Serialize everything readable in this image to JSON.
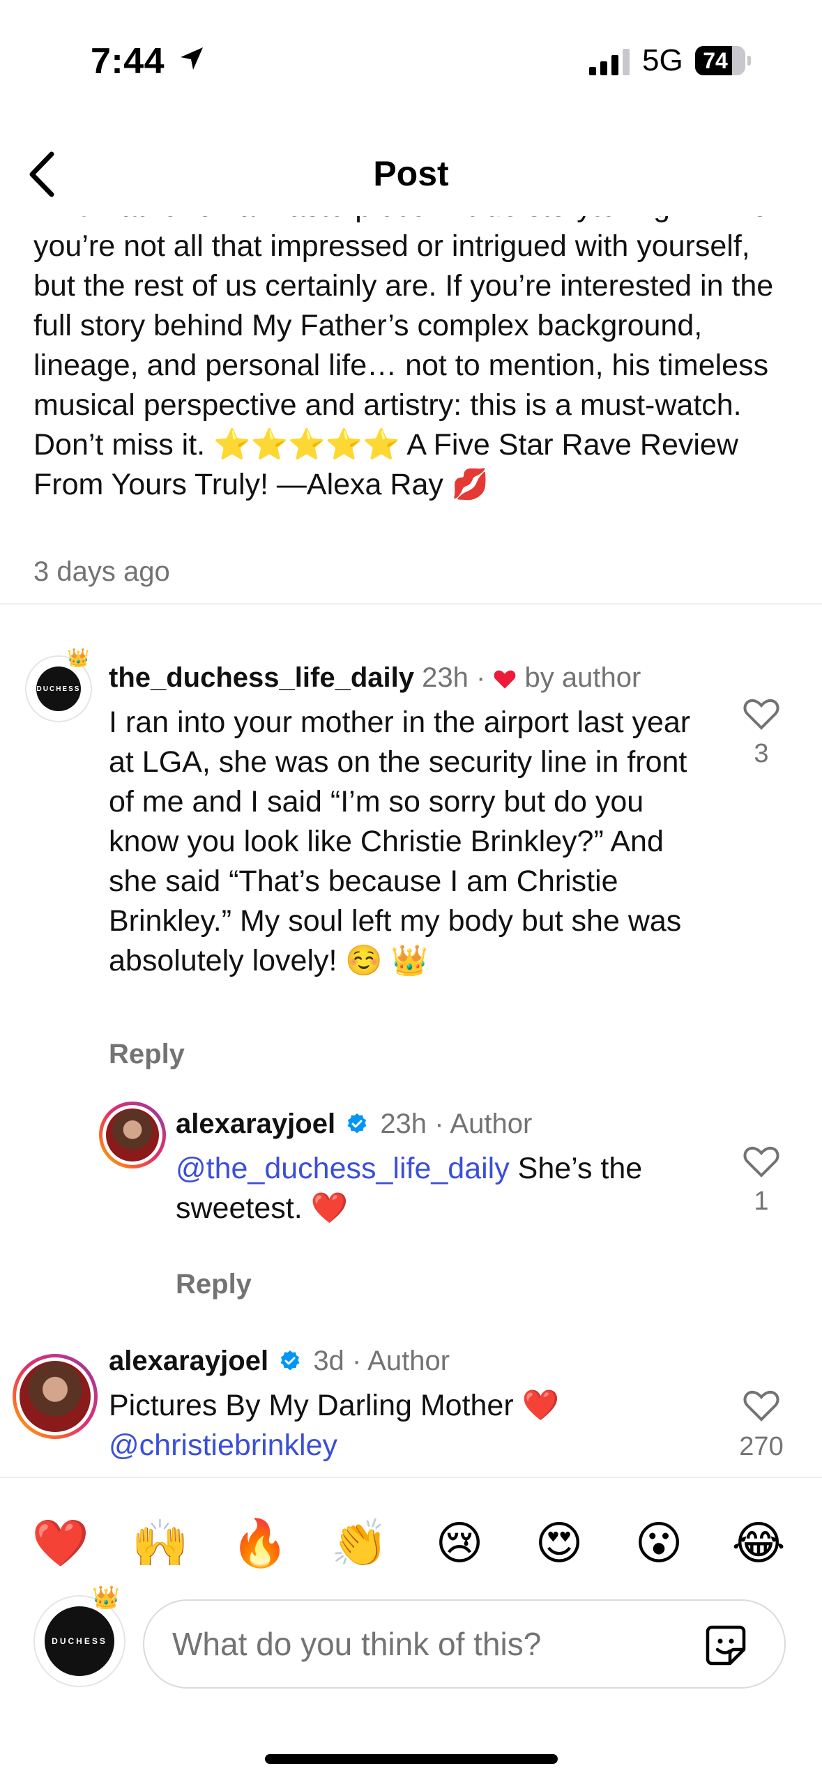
{
  "status_bar": {
    "time": "7:44",
    "network": "5G",
    "battery_level": 74,
    "battery_label": "74"
  },
  "nav": {
    "title": "Post",
    "back_icon": "chevron-left-icon"
  },
  "caption": {
    "text": "Kind Father on a masterpiece in true storytelling... I know you’re not all that impressed or intrigued with yourself, but the rest of us certainly are. If you’re interested in the full story behind My Father’s complex background, lineage, and personal life… not to mention, his timeless musical perspective and artistry: this is a must-watch. Don’t miss it. ⭐⭐⭐⭐⭐ A Five Star Rave Review From Yours Truly! —Alexa Ray 💋",
    "time": "3 days ago"
  },
  "comments": [
    {
      "username": "the_duchess_life_daily",
      "time": "23h",
      "badge": "by author",
      "text": "I ran into your mother in the airport last year at LGA, she was on the security line in front of me and I said “I’m so sorry but do you know you look like Christie Brinkley?” And she said “That’s because I am Christie Brinkley.” My soul left my body but she was absolutely lovely! ☺️ 👑",
      "reply_label": "Reply",
      "likes": "3"
    },
    {
      "username": "alexarayjoel",
      "verified": true,
      "time": "23h",
      "badge": "Author",
      "mention": "@the_duchess_life_daily",
      "text": " She’s the sweetest. ❤️",
      "reply_label": "Reply",
      "likes": "1"
    },
    {
      "username": "alexarayjoel",
      "verified": true,
      "time": "3d",
      "badge": "Author",
      "text": "Pictures By My Darling Mother ❤️",
      "mention": "@christiebrinkley",
      "likes": "270"
    }
  ],
  "reactions": [
    "❤️",
    "🙌",
    "🔥",
    "👏",
    "😢",
    "😍",
    "😮",
    "😂"
  ],
  "composer": {
    "placeholder": "What do you think of this?",
    "sticker_icon": "sticker-icon"
  },
  "colors": {
    "accent_heart": "#ed1b3a",
    "mention": "#3b4fd8",
    "verified": "#0095f6",
    "muted_text": "#737373"
  }
}
